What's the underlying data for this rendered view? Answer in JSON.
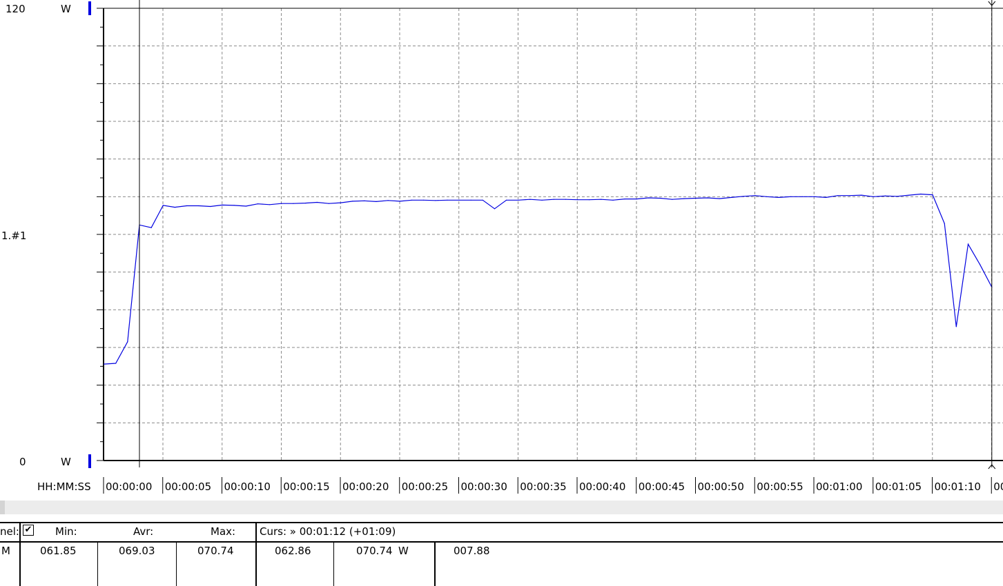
{
  "chart_data": {
    "type": "line",
    "y_axis": {
      "max_label": "120",
      "min_label": "0",
      "mid_label": "1.#1",
      "unit_top": "W",
      "unit_bottom": "W",
      "ylim": [
        0,
        120
      ]
    },
    "x_axis": {
      "format_label": "HH:MM:SS",
      "tick_labels": [
        "00:00:00",
        "00:00:05",
        "00:00:10",
        "00:00:15",
        "00:00:20",
        "00:00:25",
        "00:00:30",
        "00:00:35",
        "00:00:40",
        "00:00:45",
        "00:00:50",
        "00:00:55",
        "00:01:00",
        "00:01:05",
        "00:01:10",
        "00:"
      ],
      "xlim_seconds": [
        -3,
        79
      ]
    },
    "grid": true,
    "series": [
      {
        "color": "#0000e0",
        "points": [
          [
            -3,
            25.6
          ],
          [
            -2,
            25.8
          ],
          [
            -1,
            31.5
          ],
          [
            0,
            62.5
          ],
          [
            1,
            61.8
          ],
          [
            2,
            67.7
          ],
          [
            3,
            67.2
          ],
          [
            4,
            67.6
          ],
          [
            5,
            67.6
          ],
          [
            6,
            67.4
          ],
          [
            7,
            67.8
          ],
          [
            8,
            67.7
          ],
          [
            9,
            67.5
          ],
          [
            10,
            68.1
          ],
          [
            11,
            67.9
          ],
          [
            12,
            68.2
          ],
          [
            13,
            68.2
          ],
          [
            14,
            68.3
          ],
          [
            15,
            68.5
          ],
          [
            16,
            68.2
          ],
          [
            17,
            68.4
          ],
          [
            18,
            68.8
          ],
          [
            19,
            68.9
          ],
          [
            20,
            68.7
          ],
          [
            21,
            69.0
          ],
          [
            22,
            68.8
          ],
          [
            23,
            69.1
          ],
          [
            24,
            69.1
          ],
          [
            25,
            69.0
          ],
          [
            26,
            69.1
          ],
          [
            27,
            69.1
          ],
          [
            28,
            69.1
          ],
          [
            29,
            69.1
          ],
          [
            30,
            66.8
          ],
          [
            31,
            69.1
          ],
          [
            32,
            69.1
          ],
          [
            33,
            69.3
          ],
          [
            34,
            69.1
          ],
          [
            35,
            69.3
          ],
          [
            36,
            69.3
          ],
          [
            37,
            69.2
          ],
          [
            38,
            69.2
          ],
          [
            39,
            69.3
          ],
          [
            40,
            69.1
          ],
          [
            41,
            69.4
          ],
          [
            42,
            69.4
          ],
          [
            43,
            69.7
          ],
          [
            44,
            69.6
          ],
          [
            45,
            69.3
          ],
          [
            46,
            69.5
          ],
          [
            47,
            69.6
          ],
          [
            48,
            69.7
          ],
          [
            49,
            69.5
          ],
          [
            50,
            69.8
          ],
          [
            51,
            70.1
          ],
          [
            52,
            70.3
          ],
          [
            53,
            70.0
          ],
          [
            54,
            69.8
          ],
          [
            55,
            70.0
          ],
          [
            56,
            70.0
          ],
          [
            57,
            70.0
          ],
          [
            58,
            69.8
          ],
          [
            59,
            70.3
          ],
          [
            60,
            70.3
          ],
          [
            61,
            70.4
          ],
          [
            62,
            70.0
          ],
          [
            63,
            70.2
          ],
          [
            64,
            70.1
          ],
          [
            65,
            70.4
          ],
          [
            66,
            70.7
          ],
          [
            67,
            70.5
          ],
          [
            68,
            62.9
          ],
          [
            69,
            35.5
          ],
          [
            70,
            57.4
          ],
          [
            71,
            52.0
          ],
          [
            72,
            46.0
          ]
        ]
      }
    ],
    "cursors_seconds": [
      0,
      72
    ]
  },
  "stats": {
    "channel_label": "nel:",
    "checkbox": "✔",
    "min_label": "Min:",
    "avr_label": "Avr:",
    "max_label": "Max:",
    "cursor_label": "Curs: » 00:01:12 (+01:09)",
    "row_name": "M",
    "min": "061.85",
    "avr": "069.03",
    "max": "070.74",
    "cursor_value": "062.86",
    "cursor_value2": "070.74",
    "unit": "W",
    "delta": "007.88"
  }
}
